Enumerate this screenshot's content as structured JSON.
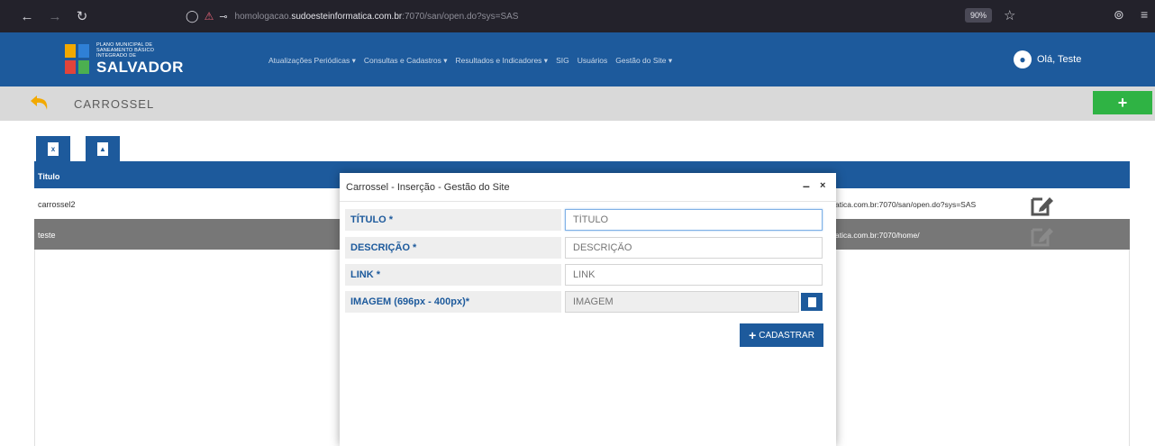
{
  "browser": {
    "url_prefix": "homologacao.",
    "url_domain": "sudoesteinformatica.com.br",
    "url_suffix": ":7070/san/open.do?sys=SAS",
    "zoom": "90%"
  },
  "header": {
    "logo_line1": "Plano Municipal de",
    "logo_line2": "Saneamento Básico",
    "logo_line3": "Integrado de",
    "logo_city": "SALVADOR",
    "menu": [
      "Atualizações Periódicas ▾",
      "Consultas e Cadastros ▾",
      "Resultados e Indicadores ▾",
      "SIG",
      "Usuários",
      "Gestão do Site ▾"
    ],
    "user_greeting": "Olá, Teste"
  },
  "page": {
    "title": "CARROSSEL",
    "add_label": "+"
  },
  "table": {
    "header_title": "Titulo",
    "rows": [
      {
        "title": "carrossel2",
        "link": "atica.com.br:7070/san/open.do?sys=SAS"
      },
      {
        "title": "teste",
        "link": "atica.com.br:7070/home/"
      }
    ]
  },
  "modal": {
    "title": "Carrossel - Inserção - Gestão do Site",
    "min": "–",
    "close": "×",
    "fields": [
      {
        "label": "TÍTULO *",
        "placeholder": "TÍTULO"
      },
      {
        "label": "DESCRIÇÃO *",
        "placeholder": "DESCRIÇÃO"
      },
      {
        "label": "LINK *",
        "placeholder": "LINK"
      },
      {
        "label": "IMAGEM (696px - 400px)*",
        "placeholder": "IMAGEM"
      }
    ],
    "submit_label": "CADASTRAR",
    "submit_plus": "+"
  },
  "colors": {
    "primary": "#1d5a9c",
    "success": "#2fb344",
    "accent": "#f2a900"
  },
  "icons": {
    "back": "undo-arrow-icon",
    "excel": "excel-file-icon",
    "pdf": "pdf-file-icon",
    "edit": "edit-icon",
    "upload": "file-upload-icon",
    "user": "user-avatar-icon"
  }
}
